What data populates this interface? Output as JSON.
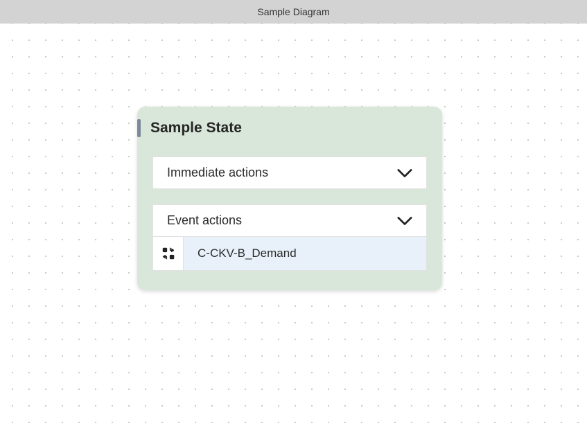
{
  "header": {
    "title": "Sample Diagram"
  },
  "state": {
    "name": "Sample State",
    "sections": {
      "immediate": {
        "label": "Immediate actions"
      },
      "event": {
        "label": "Event actions",
        "items": [
          {
            "label": "C-CKV-B_Demand",
            "icon": "transition-icon"
          }
        ]
      }
    }
  }
}
